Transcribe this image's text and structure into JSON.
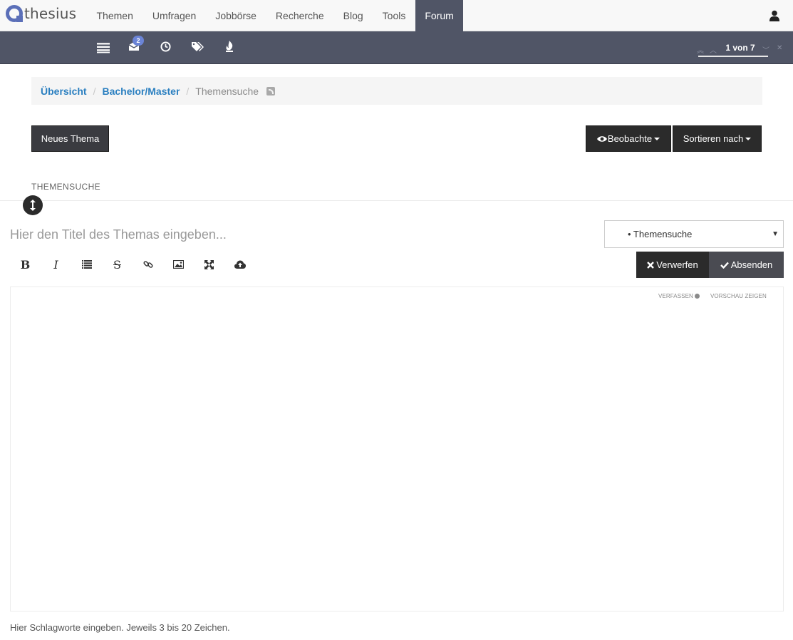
{
  "brand": {
    "name": "thesius"
  },
  "nav": {
    "items": [
      {
        "label": "Themen"
      },
      {
        "label": "Umfragen"
      },
      {
        "label": "Jobbörse"
      },
      {
        "label": "Recherche"
      },
      {
        "label": "Blog"
      },
      {
        "label": "Tools"
      },
      {
        "label": "Forum",
        "active": true
      }
    ],
    "user_icon": "user-icon"
  },
  "subnav": {
    "icons": [
      "list-icon",
      "inbox-icon",
      "clock-icon",
      "tags-icon",
      "fire-icon"
    ],
    "inbox_badge": "2",
    "pager": {
      "text": "1 von 7"
    }
  },
  "breadcrumb": {
    "items": [
      {
        "label": "Übersicht"
      },
      {
        "label": "Bachelor/Master"
      },
      {
        "label": "Themensuche"
      }
    ],
    "separator": "/"
  },
  "actions": {
    "new_topic": "Neues Thema",
    "watch": "Beobachte",
    "sort": "Sortieren nach"
  },
  "section": {
    "title": "THEMENSUCHE"
  },
  "composer": {
    "title_placeholder": "Hier den Titel des Themas eingeben...",
    "category_selected": "• Themensuche",
    "discard": "Verwerfen",
    "submit": "Absenden",
    "toolbar": [
      "bold",
      "italic",
      "list",
      "strikethrough",
      "link",
      "image",
      "fullscreen",
      "upload"
    ],
    "tab_compose": "VERFASSEN",
    "tab_preview": "VORSCHAU ZEIGEN",
    "tags_placeholder": "Hier Schlagworte eingeben. Jeweils 3 bis 20 Zeichen."
  },
  "colors": {
    "nav_active": "#505566",
    "subbar": "#505566",
    "link": "#2a7fc0",
    "button_dark": "#2b2b2b",
    "badge": "#6b84d6"
  }
}
